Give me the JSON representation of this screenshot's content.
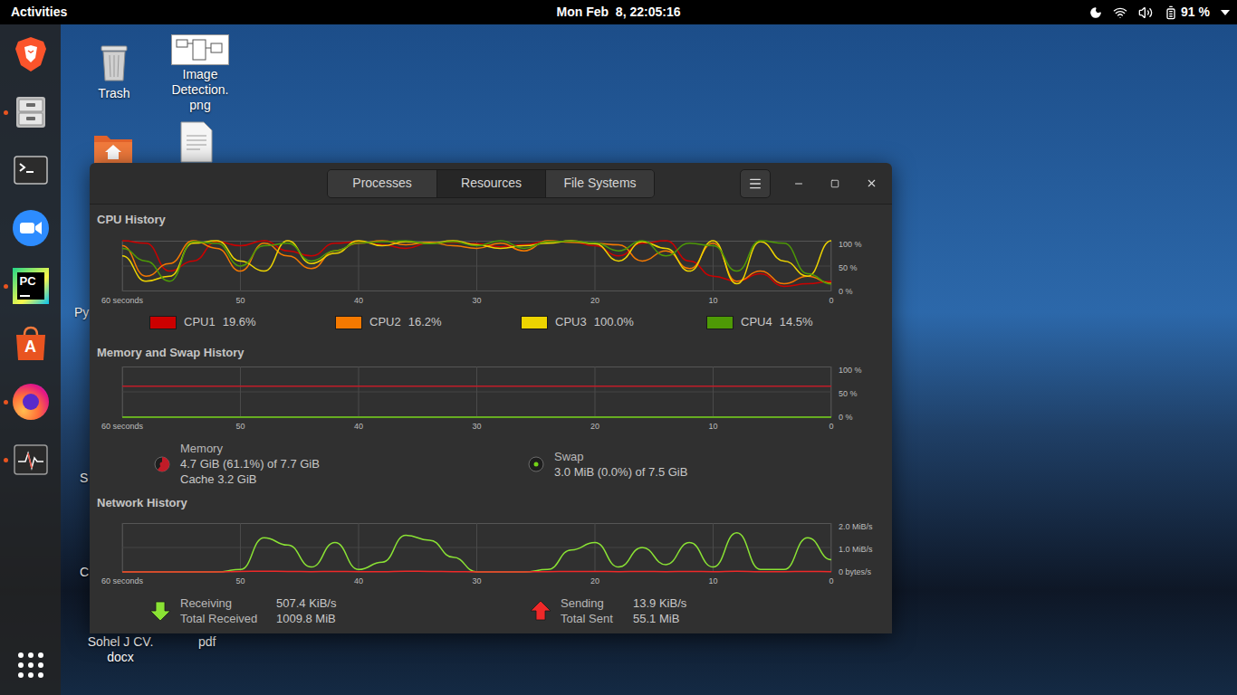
{
  "top_bar": {
    "activities": "Activities",
    "clock": "Mon Feb  8, 22:05:16",
    "battery": "91 %"
  },
  "dock": {
    "apps": [
      {
        "kind": "brave",
        "running": false,
        "text": ""
      },
      {
        "kind": "files",
        "running": true,
        "text": ""
      },
      {
        "kind": "terminal",
        "running": false,
        "text": ""
      },
      {
        "kind": "zoom",
        "running": false,
        "text": ""
      },
      {
        "kind": "pycharm",
        "running": true,
        "text": "PC"
      },
      {
        "kind": "software",
        "running": false,
        "text": "A"
      },
      {
        "kind": "firefox",
        "running": true,
        "text": ""
      },
      {
        "kind": "monitor",
        "running": true,
        "text": ""
      }
    ]
  },
  "desktop_icons": [
    {
      "kind": "trash",
      "label": "Trash"
    },
    {
      "kind": "image",
      "label": "Image Detection. png"
    }
  ],
  "desktop_hidden_icons": [
    {
      "kind": "home"
    },
    {
      "kind": "document"
    }
  ],
  "desktop_label_fragments": [
    "Py",
    "S",
    "C",
    "Sohel J CV. docx",
    "pdf"
  ],
  "window": {
    "tabs": [
      {
        "label": "Processes",
        "selected": false
      },
      {
        "label": "Resources",
        "selected": true
      },
      {
        "label": "File Systems",
        "selected": false
      }
    ]
  },
  "cpu": {
    "title": "CPU History",
    "x_ticks": [
      "60 seconds",
      "50",
      "40",
      "30",
      "20",
      "10",
      "0"
    ],
    "y_ticks": [
      "100 %",
      "50 %",
      "0 %"
    ],
    "y_max": 100,
    "series": [
      {
        "label": "CPU1",
        "reading": "19.6%",
        "color": "#cc0000",
        "values": [
          100,
          95,
          40,
          60,
          98,
          90,
          100,
          80,
          70,
          95,
          98,
          92,
          85,
          96,
          97,
          94,
          88,
          92,
          99,
          98,
          90,
          70,
          95,
          100,
          60,
          30,
          20,
          35,
          10,
          15,
          19.6
        ]
      },
      {
        "label": "CPU2",
        "reading": "16.2%",
        "color": "#f57900",
        "values": [
          90,
          30,
          55,
          100,
          85,
          40,
          95,
          70,
          45,
          80,
          95,
          100,
          92,
          97,
          90,
          85,
          95,
          80,
          100,
          97,
          95,
          92,
          60,
          80,
          45,
          95,
          20,
          40,
          15,
          30,
          16.2
        ]
      },
      {
        "label": "CPU3",
        "reading": "100.0%",
        "color": "#edd400",
        "values": [
          70,
          20,
          30,
          95,
          100,
          60,
          40,
          100,
          55,
          75,
          100,
          90,
          98,
          95,
          100,
          92,
          85,
          90,
          95,
          100,
          94,
          60,
          98,
          85,
          40,
          100,
          15,
          98,
          60,
          30,
          100
        ]
      },
      {
        "label": "CPU4",
        "reading": "14.5%",
        "color": "#4e9a06",
        "values": [
          85,
          60,
          20,
          98,
          95,
          50,
          90,
          95,
          60,
          80,
          96,
          98,
          100,
          94,
          98,
          90,
          100,
          85,
          98,
          99,
          96,
          80,
          100,
          70,
          95,
          90,
          40,
          100,
          95,
          35,
          14.5
        ]
      }
    ]
  },
  "memory": {
    "title": "Memory and Swap History",
    "x_ticks": [
      "60 seconds",
      "50",
      "40",
      "30",
      "20",
      "10",
      "0"
    ],
    "y_ticks": [
      "100 %",
      "50 %",
      "0 %"
    ],
    "y_max": 100,
    "series": [
      {
        "label": "Memory",
        "lines": [
          "4.7 GiB (61.1%) of 7.7 GiB",
          "Cache 3.2 GiB"
        ],
        "level": 0.611,
        "color": "#c01c28",
        "values": [
          61,
          61,
          61,
          61,
          61,
          61,
          61,
          61,
          61,
          61,
          61,
          61,
          61,
          61,
          61,
          61,
          61,
          61,
          61,
          61,
          61,
          61,
          61,
          61,
          61,
          61,
          61,
          61,
          61,
          61,
          61.1
        ]
      },
      {
        "label": "Swap",
        "lines": [
          "3.0 MiB (0.0%) of 7.5 GiB"
        ],
        "level": 0.0,
        "color": "#73d216",
        "values": [
          0,
          0,
          0,
          0,
          0,
          0,
          0,
          0,
          0,
          0,
          0,
          0,
          0,
          0,
          0,
          0,
          0,
          0,
          0,
          0,
          0,
          0,
          0,
          0,
          0,
          0,
          0,
          0,
          0,
          0,
          0
        ]
      }
    ]
  },
  "network": {
    "title": "Network History",
    "x_ticks": [
      "60 seconds",
      "50",
      "40",
      "30",
      "20",
      "10",
      "0"
    ],
    "y_ticks": [
      "2.0 MiB/s",
      "1.0 MiB/s",
      "0 bytes/s"
    ],
    "y_max": 2.0,
    "series": [
      {
        "label": "Receiving",
        "rate": "507.4 KiB/s",
        "total_label": "Total Received",
        "total": "1009.8 MiB",
        "direction": "down",
        "color": "#8ae234",
        "values": [
          0,
          0,
          0,
          0,
          0,
          0.1,
          1.4,
          1.1,
          0.2,
          1.2,
          0.1,
          0.4,
          1.5,
          1.3,
          0.6,
          0,
          0,
          0,
          0.1,
          0.9,
          1.2,
          0.2,
          1.0,
          0.3,
          1.2,
          0.2,
          1.6,
          0.1,
          0.1,
          1.4,
          0.5
        ]
      },
      {
        "label": "Sending",
        "rate": "13.9 KiB/s",
        "total_label": "Total Sent",
        "total": "55.1 MiB",
        "direction": "up",
        "color": "#ef2929",
        "values": [
          0,
          0,
          0,
          0,
          0,
          0.02,
          0.03,
          0.02,
          0.01,
          0.02,
          0.01,
          0.01,
          0.03,
          0.02,
          0.01,
          0,
          0,
          0,
          0.01,
          0.02,
          0.02,
          0.01,
          0.02,
          0.01,
          0.02,
          0.01,
          0.03,
          0.01,
          0.01,
          0.02,
          0.01
        ]
      }
    ]
  }
}
